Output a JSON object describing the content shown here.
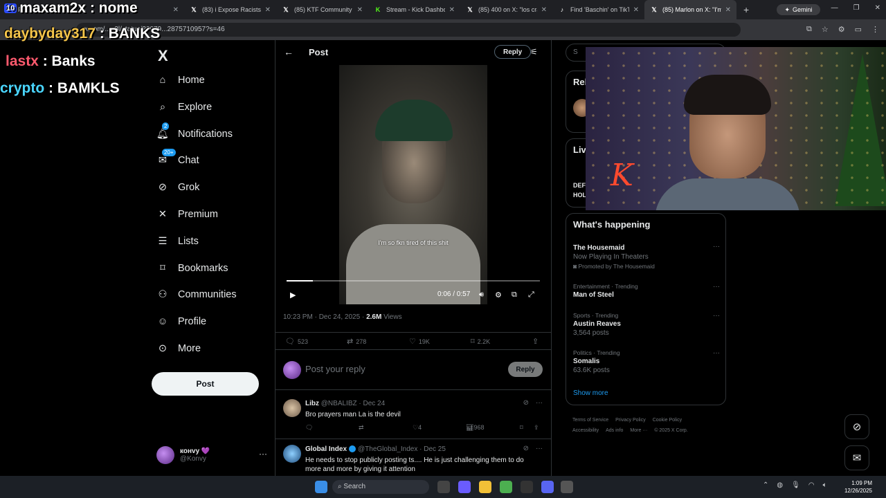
{
  "browser": {
    "tabs": [
      {
        "title": "Pr...",
        "icon": "tab-icon",
        "color": "#5f6368",
        "active": false
      },
      {
        "title": "...",
        "icon": "tab-icon",
        "color": "#5f6368",
        "active": false
      },
      {
        "title": "(83) i Expose Racists & ",
        "icon": "x-logo",
        "color": "#ffffff",
        "active": false
      },
      {
        "title": "(85) KTF Community / X",
        "icon": "x-logo",
        "color": "#ffffff",
        "active": false
      },
      {
        "title": "Stream - Kick Dashboar",
        "icon": "kick-logo",
        "color": "#53fc18",
        "active": false
      },
      {
        "title": "(85) 400 on X: \"los crash",
        "icon": "x-logo",
        "color": "#ffffff",
        "active": false
      },
      {
        "title": "Find 'Baschin' on TikTok",
        "icon": "tiktok-logo",
        "color": "#ffffff",
        "active": false
      },
      {
        "title": "(85) Marlon on X: \"I'm s",
        "icon": "x-logo",
        "color": "#ffffff",
        "active": true
      }
    ],
    "gemini_label": "Gemini",
    "address": "x.com/...p3l/status/20079...2875710957?s=46"
  },
  "overlay": {
    "line1_badge": "10",
    "line1": "maxam2x : nome",
    "line2_user": "daybyday317",
    "line2_sep": " : ",
    "line2_value": "BANKS",
    "line3_user": "lastx",
    "line3_sep": " : ",
    "line3_value": "Banks",
    "line4_user": "crypto",
    "line4_sep": " : ",
    "line4_value": "BAMKLS",
    "colors": {
      "line2_user": "#f5c54a",
      "line3_user": "#ff5a6e",
      "line4_user": "#4ad6ff",
      "values": "#ffffff"
    }
  },
  "nav": {
    "logo": "X",
    "items": [
      {
        "label": "Home",
        "icon": "home-icon"
      },
      {
        "label": "Explore",
        "icon": "search-icon"
      },
      {
        "label": "Notifications",
        "icon": "bell-icon",
        "badge": "2"
      },
      {
        "label": "Chat",
        "icon": "chat-icon",
        "badge": "20+"
      },
      {
        "label": "Grok",
        "icon": "grok-icon"
      },
      {
        "label": "Premium",
        "icon": "x-icon"
      },
      {
        "label": "Lists",
        "icon": "list-icon"
      },
      {
        "label": "Bookmarks",
        "icon": "bookmark-icon"
      },
      {
        "label": "Communities",
        "icon": "communities-icon"
      },
      {
        "label": "Profile",
        "icon": "profile-icon"
      },
      {
        "label": "More",
        "icon": "more-icon"
      }
    ],
    "post_button": "Post",
    "account": {
      "name": "конvy 💜",
      "handle": "@Konvy"
    }
  },
  "post": {
    "header_title": "Post",
    "reply_top": "Reply",
    "video": {
      "subtitle": "I'm so fkn tired of this shit",
      "time": "0:06 / 0:57",
      "progress": 0.105
    },
    "timestamp": "10:23 PM · Dec 24, 2025 · ",
    "views_count": "2.6M",
    "views_label": " Views",
    "stats": {
      "replies": "523",
      "reposts": "278",
      "likes": "19K",
      "bookmarks": "2.2K"
    },
    "reply_placeholder": "Post your reply",
    "reply_button": "Reply"
  },
  "replies": [
    {
      "name": "Libz",
      "handle": "@NBALIBZ · Dec 24",
      "verified": false,
      "text": "Bro prayers man La is the devil",
      "likes": "4",
      "views": "968"
    },
    {
      "name": "Global Index",
      "handle": "@TheGlobal_Index · Dec 25",
      "verified": true,
      "text": "He needs to stop publicly posting ts.... He is just challenging them to do more and more by giving it attention"
    }
  ],
  "sidebar": {
    "search_placeholder": "S",
    "relevant_title": "Rel",
    "live_title": "Liv",
    "live_line1": "DEF",
    "live_line2": "HOL",
    "whats_happening": "What's happening",
    "trends": [
      {
        "category": "",
        "name": "The Housemaid",
        "sub": "Now Playing In Theaters",
        "promo": "Promoted by The Housemaid"
      },
      {
        "category": "Entertainment · Trending",
        "name": "Man of Steel",
        "sub": ""
      },
      {
        "category": "Sports · Trending",
        "name": "Austin Reaves",
        "sub": "3,564 posts"
      },
      {
        "category": "Politics · Trending",
        "name": "Somalis",
        "sub": "63.6K posts"
      }
    ],
    "show_more": "Show more",
    "footer_links": [
      "Terms of Service",
      "Privacy Policy",
      "Cookie Policy",
      "Accessibility",
      "Ads info",
      "More ···",
      "© 2025 X Corp."
    ]
  },
  "taskbar": {
    "search": "Search",
    "time": "1:09 PM",
    "date": "12/26/2025"
  }
}
